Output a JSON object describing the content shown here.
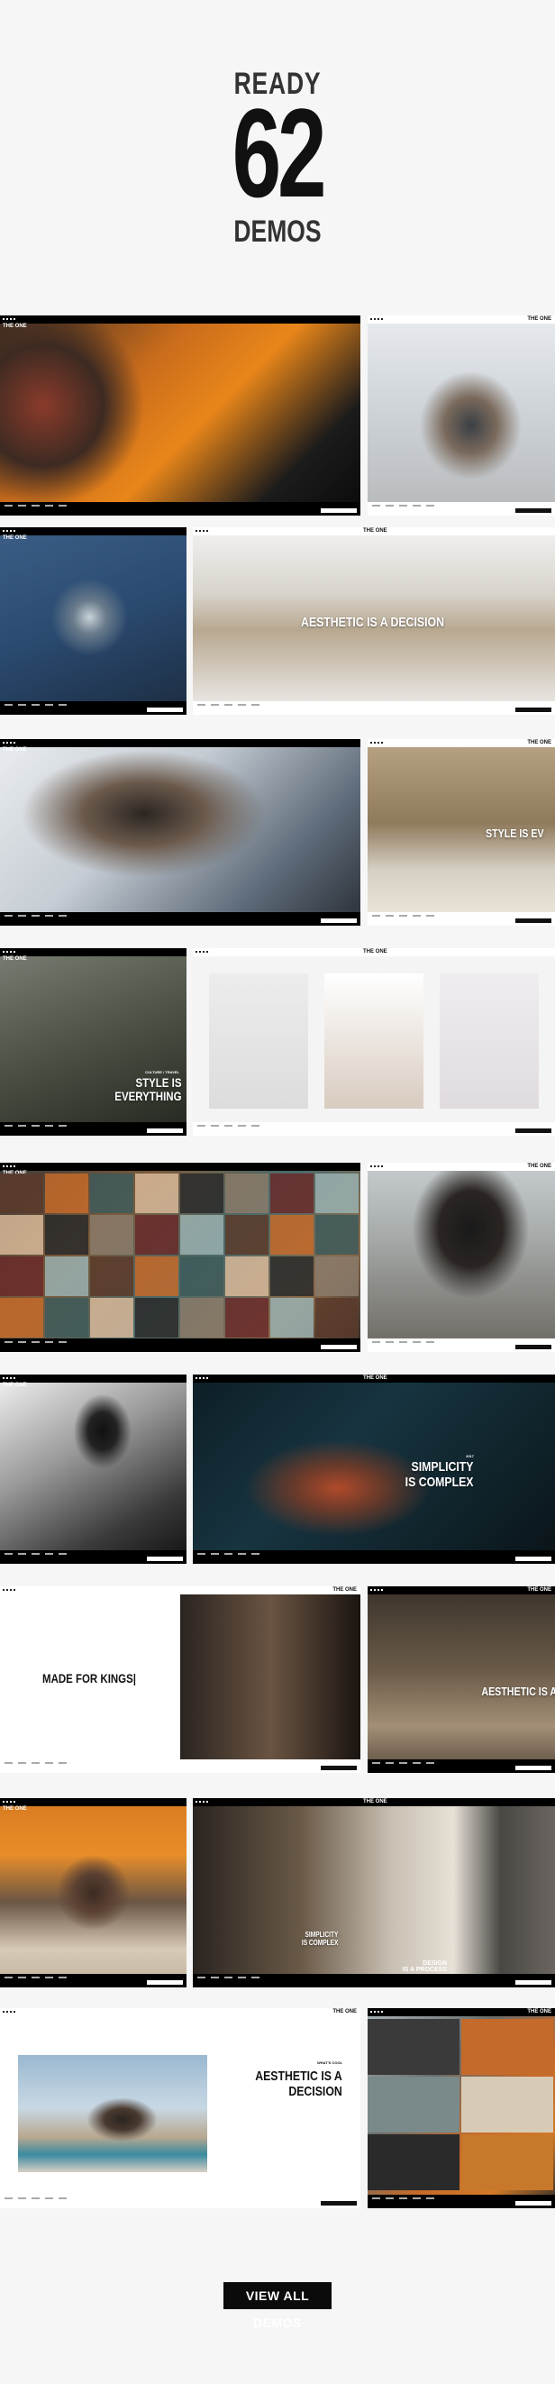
{
  "hero": {
    "line1": "READY",
    "number": "62",
    "line3": "DEMOS"
  },
  "brand": "THE ONE",
  "captions": {
    "aesthetic_decision": "AESTHETIC IS A DECISION",
    "style_everything_1": "STYLE IS",
    "style_everything_2": "EVERYTHING",
    "style_partial": "STYLE IS EV",
    "culture": "CULTURE / TRAVEL",
    "simplicity_1": "SIMPLICITY",
    "simplicity_2": "IS COMPLEX",
    "year": "2017",
    "made_for_kings": "MADE FOR KINGS|",
    "aesthetic_partial": "AESTHETIC IS A",
    "simplicity_small_1": "SIMPLICITY",
    "simplicity_small_2": "IS COMPLEX",
    "design_1": "DESIGN",
    "design_2": "IS A PROCESS",
    "aesthetic_decision_2a": "AESTHETIC IS A",
    "aesthetic_decision_2b": "DECISION",
    "whats_cool": "WHAT'S COOL"
  },
  "cta": {
    "label": "VIEW ALL DEMOS"
  },
  "colors": {
    "background": "#f6f6f6",
    "accent": "#0b0b0b"
  }
}
